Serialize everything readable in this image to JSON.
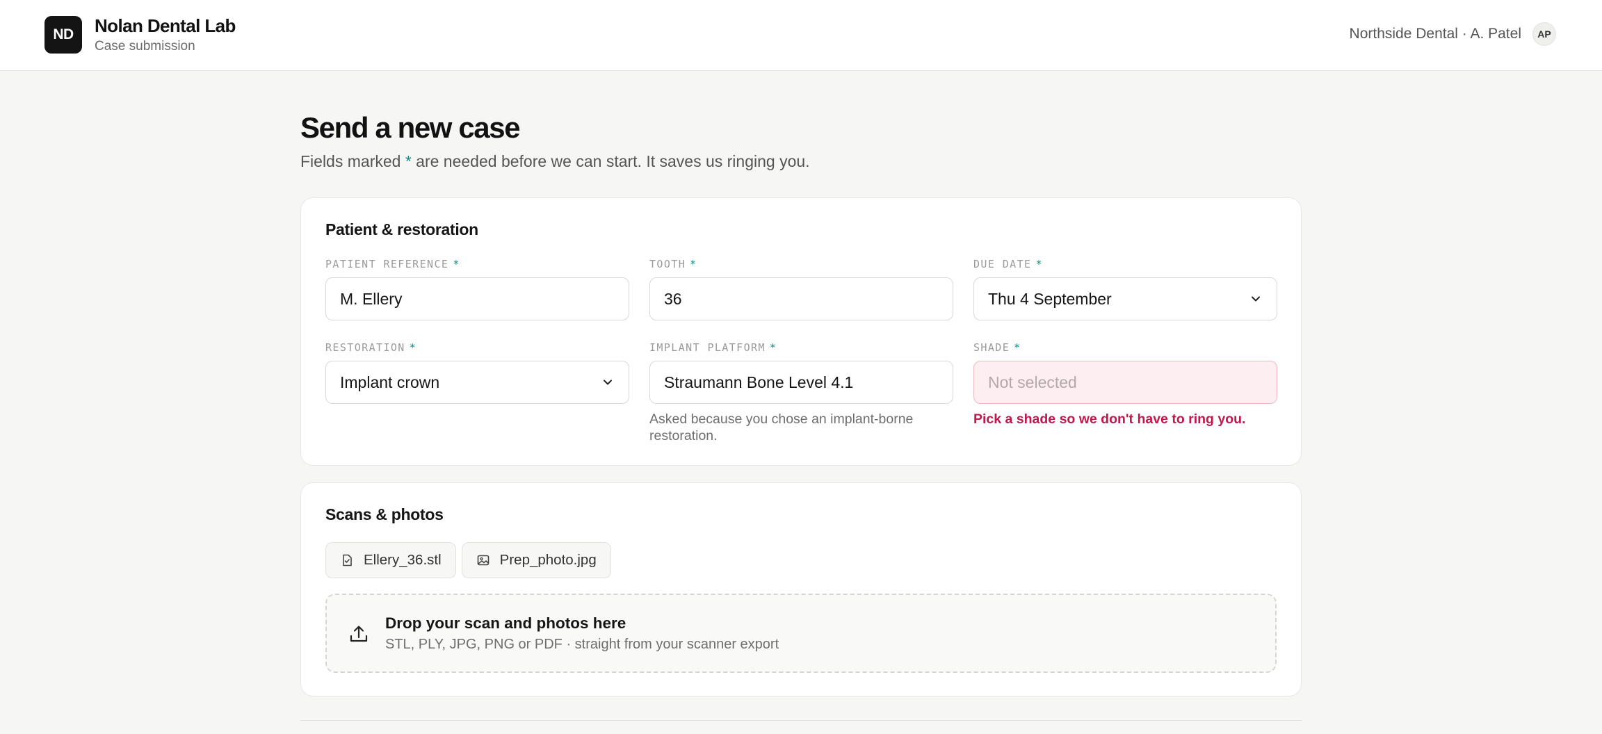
{
  "header": {
    "logo_initials": "ND",
    "brand_name": "Nolan Dental Lab",
    "brand_sub": "Case submission",
    "account_text": "Northside Dental · A. Patel",
    "avatar_initials": "AP"
  },
  "page": {
    "title": "Send a new case",
    "sub_before": "Fields marked ",
    "sub_star": "*",
    "sub_after": " are needed before we can start. It saves us ringing you."
  },
  "patient_card": {
    "title": "Patient & restoration",
    "required_mark": "*",
    "patient_reference": {
      "label": "Patient reference",
      "value": "M. Ellery"
    },
    "tooth": {
      "label": "Tooth",
      "value": "36"
    },
    "due_date": {
      "label": "Due date",
      "value": "Thu 4 September"
    },
    "restoration": {
      "label": "Restoration",
      "value": "Implant crown"
    },
    "implant_platform": {
      "label": "Implant platform",
      "value": "Straumann Bone Level 4.1",
      "hint": "Asked because you chose an implant-borne restoration."
    },
    "shade": {
      "label": "Shade",
      "placeholder": "Not selected",
      "error": "Pick a shade so we don't have to ring you."
    }
  },
  "scans_card": {
    "title": "Scans & photos",
    "files": [
      {
        "name": "Ellery_36.stl",
        "icon": "file-check-icon"
      },
      {
        "name": "Prep_photo.jpg",
        "icon": "image-icon"
      }
    ],
    "dropzone": {
      "title": "Drop your scan and photos here",
      "sub": "STL, PLY, JPG, PNG or PDF · straight from your scanner export",
      "icon": "upload-icon"
    }
  },
  "colors": {
    "accent": "#0f8a7e",
    "error": "#c0184a",
    "error_bg": "#fdeff1",
    "logo_bg": "#141414"
  }
}
